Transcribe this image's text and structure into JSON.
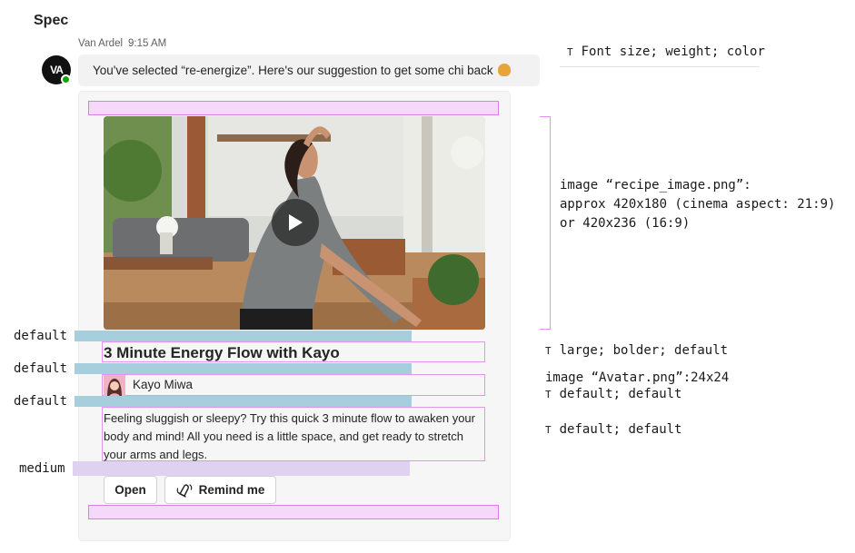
{
  "spec_title": "Spec",
  "message": {
    "sender": "Van Ardel",
    "time": "9:15 AM",
    "avatar_initials": "VA",
    "text": "You've selected “re-energize”.  Here's our suggestion to get some chi back"
  },
  "card": {
    "title": "3 Minute Energy Flow with Kayo",
    "author": "Kayo Miwa",
    "description": "Feeling sluggish or sleepy? Try this quick 3 minute flow to awaken your body and mind! All you need is a little space, and get ready to stretch your arms and legs.",
    "buttons": {
      "open": "Open",
      "remind": "Remind me"
    }
  },
  "left_labels": {
    "l1": "default",
    "l2": "default",
    "l3": "default",
    "l4": "medium"
  },
  "annotations": {
    "font_note": "Font size; weight; color",
    "image_note_line1": "image “recipe_image.png”:",
    "image_note_line2": "approx 420x180 (cinema aspect: 21:9)",
    "image_note_line3": "or 420x236 (16:9)",
    "title_note": "large; bolder; default",
    "avatar_note": "image “Avatar.png”:24x24",
    "author_note": "default; default",
    "desc_note": "default; default",
    "t_glyph": "T"
  },
  "colors": {
    "pink_fill": "#f5d8fa",
    "pink_outline": "#e294ef",
    "blue_bar": "#a7cedd",
    "violet_bar": "#ddd3f1",
    "presence": "#13a10e"
  }
}
